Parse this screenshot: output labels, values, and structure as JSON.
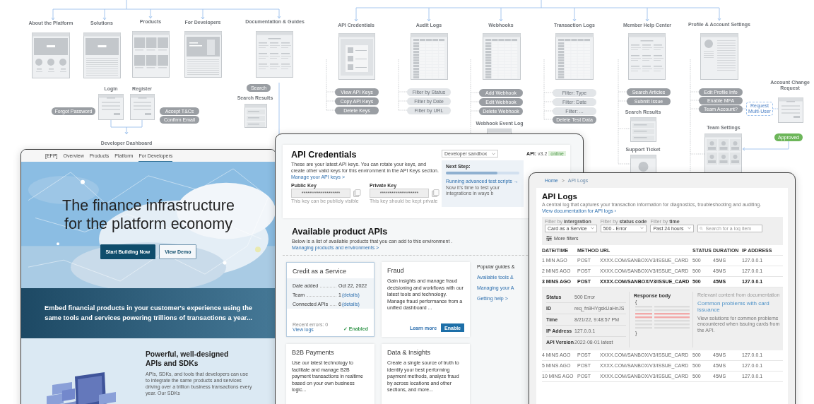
{
  "sitemap": {
    "nodes": [
      {
        "title": "About the Platform",
        "kind": "hero"
      },
      {
        "title": "Solutions",
        "kind": "article"
      },
      {
        "title": "Products",
        "kind": "grid"
      },
      {
        "title": "For Developers",
        "kind": "device"
      },
      {
        "title": "Documentation & Guides",
        "kind": "docs"
      },
      {
        "title": "Login",
        "kind": "form"
      },
      {
        "title": "Register",
        "kind": "form"
      },
      {
        "title": "Search Results",
        "kind": "list"
      },
      {
        "title": "Developer Dashboard",
        "kind": "none"
      },
      {
        "title": "API Credentials",
        "kind": "keys"
      },
      {
        "title": "Audit Logs",
        "kind": "table"
      },
      {
        "title": "Webhooks",
        "kind": "table"
      },
      {
        "title": "Webhook Event Log",
        "kind": "list"
      },
      {
        "title": "Transaction Logs",
        "kind": "table"
      },
      {
        "title": "Member Help Center",
        "kind": "docs"
      },
      {
        "title": "Search Results",
        "kind": "list"
      },
      {
        "title": "Support Ticket",
        "kind": "ticket"
      },
      {
        "title": "Profile & Account Settings",
        "kind": "profile"
      },
      {
        "title": "Account Change Request",
        "kind": "form"
      },
      {
        "title": "Team Settings",
        "kind": "team"
      }
    ],
    "actions": [
      {
        "label": "Forgot Password",
        "kind": "step"
      },
      {
        "label": "Accept T&Cs",
        "kind": "step"
      },
      {
        "label": "Confirm Email",
        "kind": "step"
      },
      {
        "label": "Search",
        "kind": "step"
      },
      {
        "label": "View API Keys",
        "kind": "step"
      },
      {
        "label": "Copy API Keys",
        "kind": "step"
      },
      {
        "label": "Delete Keys",
        "kind": "step"
      },
      {
        "label": "Filter by Status",
        "kind": "filter"
      },
      {
        "label": "Filter by Date",
        "kind": "filter"
      },
      {
        "label": "Filter by URL",
        "kind": "filter"
      },
      {
        "label": "Add Webhook",
        "kind": "step"
      },
      {
        "label": "Edit Webhook",
        "kind": "step"
      },
      {
        "label": "Delete Webhook",
        "kind": "step"
      },
      {
        "label": "Filter: Type",
        "kind": "filter"
      },
      {
        "label": "Filter: Date",
        "kind": "filter"
      },
      {
        "label": "Filter: ...",
        "kind": "filter"
      },
      {
        "label": "Delete Test Data",
        "kind": "step"
      },
      {
        "label": "Search Articles",
        "kind": "step"
      },
      {
        "label": "Submit Issue",
        "kind": "step"
      },
      {
        "label": "Edit Profile Info",
        "kind": "step"
      },
      {
        "label": "Enable MFA",
        "kind": "step"
      },
      {
        "label": "Team Account?",
        "kind": "step"
      },
      {
        "label": "Request Multi-User",
        "kind": "note"
      },
      {
        "label": "Approved",
        "kind": "approved"
      }
    ]
  },
  "landing": {
    "logo": "[EFP]",
    "tabs": [
      {
        "label": "Overview",
        "selected": false
      },
      {
        "label": "Products",
        "selected": false
      },
      {
        "label": "Platform",
        "selected": false
      },
      {
        "label": "For Developers",
        "selected": true
      }
    ],
    "heading": "The finance infrastructure for the platform economy",
    "buttons": [
      {
        "label": "Start Building Now",
        "kind": "primary"
      },
      {
        "label": "View Demo",
        "kind": "secondary"
      }
    ],
    "tagline": "Embed financial products in your customer's experience using the same tools and services powering trillions of transactions a year...",
    "feature_title": "Powerful, well-designed APIs and SDKs",
    "feature_text": "APIs, SDKs, and tools that developers can use to integrate the same products and services driving over a trillion business transactions every year. Our SDKs"
  },
  "dashboard": {
    "credentials": {
      "title": "API Credentials",
      "description": "These are your latest API keys.  You can rotate your keys, and create other valid keys for this environment in the API Keys section.",
      "link": "Manage your API keys >",
      "environment": "Developer sandbox",
      "api_label": "API:",
      "api_version": "v3.2",
      "status": "online",
      "keys": [
        {
          "label": "Public Key",
          "value": "********************",
          "hint": "This key can be publicly visible"
        },
        {
          "label": "Private Key",
          "value": "********************",
          "hint": "This key should be kept private"
        }
      ],
      "next_step": {
        "label": "Next Step:",
        "level": 0.7,
        "link": "Running advanced test scripts →",
        "note": "Now it's time to test your integrations in ways b"
      }
    },
    "products": {
      "title": "Available product APIs",
      "description": "Below is a list of available products that you can add to this environment .",
      "link": "Managing products and environments >",
      "cards": [
        {
          "name": "Credit as a Service",
          "enabled": true,
          "details": [
            {
              "label": "Date added",
              "value": "Oct 22, 2022"
            },
            {
              "label": "Team",
              "value": "1",
              "link": "(details)"
            },
            {
              "label": "Connected APIs",
              "value": "6",
              "link": "(details)"
            }
          ],
          "errors": "Recent errors: 0",
          "logs_link": "View logs",
          "status": "✓ Enabled"
        },
        {
          "name": "Fraud",
          "enabled": false,
          "description": "Gain insights and manage fraud decisioning and workflows with our latest tools and technology.  Manage fraud performance from a unified dashboard ...",
          "learn_more": "Learn more",
          "action": "Enable"
        },
        {
          "name": "B2B Payments",
          "enabled": false,
          "description": "Use our latest technology to facilitate and manage B2B payment transactions in realtime based on your own business logic..."
        },
        {
          "name": "Data & Insights",
          "enabled": false,
          "description": "Create a single source of truth to identify your best performing payment methods, analyze fraud by across locations and other sections, and more..."
        }
      ],
      "guides": {
        "title": "Popular guides &",
        "links": [
          "Available tools &",
          "Managing your A",
          "Getting help >"
        ]
      }
    }
  },
  "logs": {
    "breadcrumb": {
      "home": "Home",
      "separator": ">",
      "current": "API Logs"
    },
    "title": "API Logs",
    "description": "A central log that captures your transaction information for diagnostics, troubleshooting and auditing.",
    "doc_link": "View documentation for API logs ›",
    "filters": [
      {
        "label": "Filter by **intergration**",
        "value": "Card as a Service"
      },
      {
        "label": "Filter by **status code**",
        "value": "500 - Error"
      },
      {
        "label": "Filter by **time**",
        "value": "Past 24 hours"
      }
    ],
    "search": {
      "placeholder": "Search for a log item"
    },
    "more_filters": "More filters",
    "columns": [
      "DATE/TIME",
      "METHOD",
      "URL",
      "STATUS",
      "DURATION",
      "IP ADDRESS"
    ],
    "rows": [
      {
        "cells": [
          "1 MIN AGO",
          "POST",
          "XXXX.COM/SANBOX/V3/ISSUE_CARD",
          "500",
          "45MS",
          "127.0.0.1"
        ],
        "expanded": false
      },
      {
        "cells": [
          "2 MINS AGO",
          "POST",
          "XXXX.COM/SANBOX/V3/ISSUE_CARD",
          "500",
          "45MS",
          "127.0.0.1"
        ],
        "expanded": false
      },
      {
        "cells": [
          "3 MINS AGO",
          "POST",
          "XXXX.COM/SANBOX/V3/ISSUE_CARD",
          "500",
          "45MS",
          "127.0.0.1"
        ],
        "expanded": true,
        "details": {
          "fields": [
            {
              "label": "Status",
              "value": "500 Error"
            },
            {
              "label": "ID",
              "value": "req_fn9HYgskUaHnJS"
            },
            {
              "label": "Time",
              "value": "8/21/22, 9:48:57 PM"
            },
            {
              "label": "IP Address",
              "value": "127.0.0.1"
            },
            {
              "label": "API Version",
              "value": "2022-08-01 latest"
            }
          ],
          "response_title": "Response body",
          "open_brace": "{",
          "close_brace": "}",
          "doc_caption": "Relevant content from documentation",
          "doc_title": "Common problems with card issuance",
          "doc_text": "View solutions for common problems encountered when issuing cards from the API."
        }
      },
      {
        "cells": [
          "4 MINS AGO",
          "POST",
          "XXXX.COM/SANBOX/V3/ISSUE_CARD",
          "500",
          "45MS",
          "127.0.0.1"
        ],
        "expanded": false
      },
      {
        "cells": [
          "5 MINS AGO",
          "POST",
          "XXXX.COM/SANBOX/V3/ISSUE_CARD",
          "500",
          "45MS",
          "127.0.0.1"
        ],
        "expanded": false
      },
      {
        "cells": [
          "10 MINS AGO",
          "POST",
          "XXXX.COM/SANBOX/V3/ISSUE_CARD",
          "500",
          "45MS",
          "127.0.0.1"
        ],
        "expanded": false
      }
    ]
  }
}
